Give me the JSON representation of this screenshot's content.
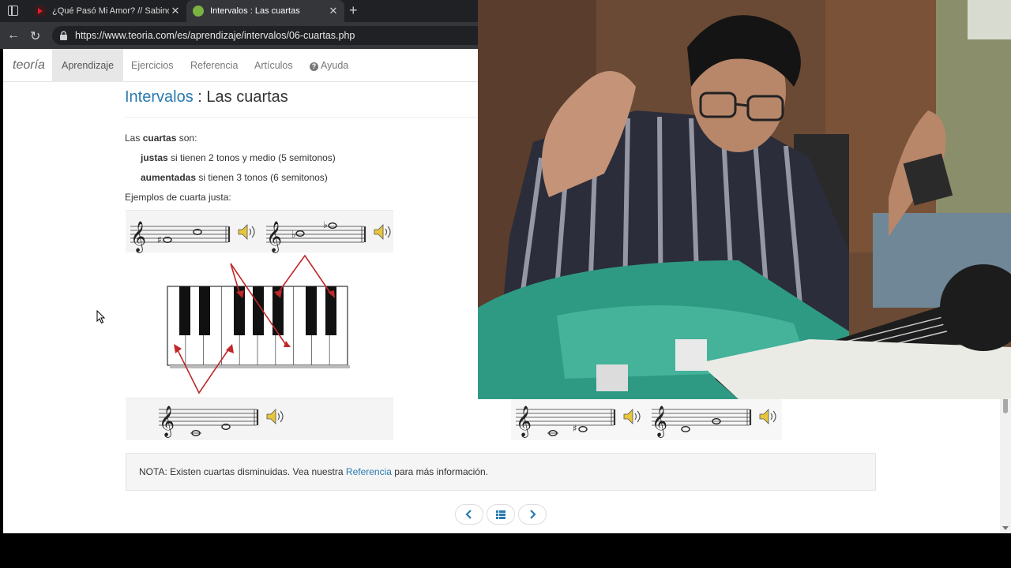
{
  "browser": {
    "tabs": [
      {
        "title": "¿Qué Pasó Mi Amor? // Sabino (L",
        "active": false
      },
      {
        "title": "Intervalos : Las cuartas",
        "active": true
      }
    ],
    "new_tab": "+",
    "url": "https://www.teoria.com/es/aprendizaje/intervalos/06-cuartas.php"
  },
  "site": {
    "brand": "teoría",
    "nav": [
      "Aprendizaje",
      "Ejercicios",
      "Referencia",
      "Artículos",
      "Ayuda"
    ],
    "active_nav": "Aprendizaje"
  },
  "content": {
    "title_link": "Intervalos",
    "title_rest": " : Las cuartas",
    "intro_pre": "Las ",
    "intro_bold": "cuartas",
    "intro_post": " son:",
    "justas_bold": "justas",
    "justas_rest": " si tienen 2 tonos y medio (5 semitonos)",
    "aumentadas_bold": "aumentadas",
    "aumentadas_rest": " si tienen 3 tonos (6 semitonos)",
    "examples_label": "Ejemplos de cuarta justa:",
    "note_pre": "NOTA: Existen cuartas disminuidas. Vea nuestra ",
    "note_link": "Referencia",
    "note_post": " para más información."
  },
  "colors": {
    "link": "#2a7ab0",
    "arrow": "#c0282a",
    "chrome_dark": "#202124"
  },
  "icons": [
    "back-arrow-icon",
    "reload-icon",
    "lock-icon",
    "speaker-icon",
    "chevron-left-icon",
    "list-icon",
    "chevron-right-icon",
    "help-circle-icon",
    "cursor-icon"
  ]
}
